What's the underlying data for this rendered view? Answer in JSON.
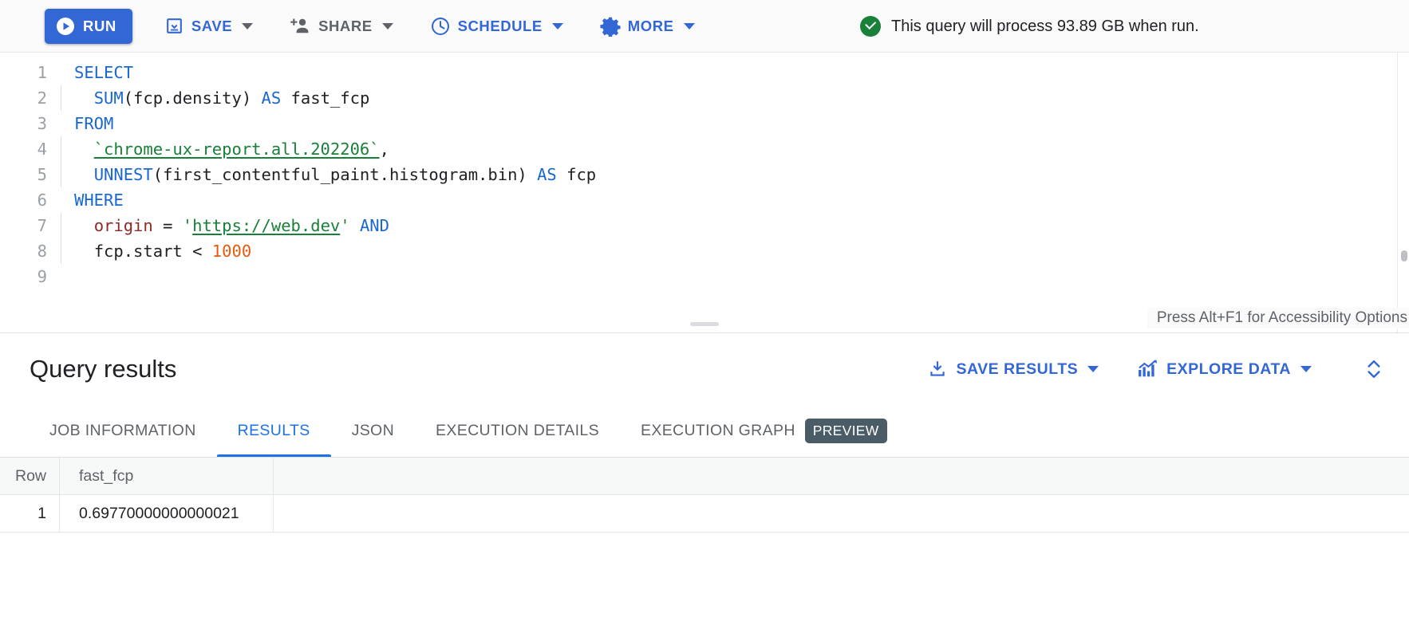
{
  "toolbar": {
    "run_label": "RUN",
    "save_label": "SAVE",
    "share_label": "SHARE",
    "schedule_label": "SCHEDULE",
    "more_label": "MORE",
    "status_text": "This query will process 93.89 GB when run.",
    "status_icon": "check-circle-icon",
    "accent_color": "#3367d6",
    "status_color": "#188038"
  },
  "editor": {
    "line_numbers": [
      "1",
      "2",
      "3",
      "4",
      "5",
      "6",
      "7",
      "8",
      "9"
    ],
    "lines": [
      {
        "n": "1",
        "tokens": [
          {
            "t": "SELECT",
            "c": "kw"
          }
        ]
      },
      {
        "n": "2",
        "tokens": [
          {
            "t": "  ",
            "c": "plain"
          },
          {
            "t": "SUM",
            "c": "kw"
          },
          {
            "t": "(fcp.density) ",
            "c": "plain"
          },
          {
            "t": "AS",
            "c": "kw"
          },
          {
            "t": " fast_fcp",
            "c": "plain"
          }
        ]
      },
      {
        "n": "3",
        "tokens": [
          {
            "t": "FROM",
            "c": "kw"
          }
        ]
      },
      {
        "n": "4",
        "tokens": [
          {
            "t": "  ",
            "c": "plain"
          },
          {
            "t": "`chrome-ux-report.all.202206`",
            "c": "tbl"
          },
          {
            "t": ",",
            "c": "plain"
          }
        ]
      },
      {
        "n": "5",
        "tokens": [
          {
            "t": "  ",
            "c": "plain"
          },
          {
            "t": "UNNEST",
            "c": "kw"
          },
          {
            "t": "(first_contentful_paint.histogram.bin) ",
            "c": "plain"
          },
          {
            "t": "AS",
            "c": "kw"
          },
          {
            "t": " fcp",
            "c": "plain"
          }
        ]
      },
      {
        "n": "6",
        "tokens": [
          {
            "t": "WHERE",
            "c": "kw"
          }
        ]
      },
      {
        "n": "7",
        "tokens": [
          {
            "t": "  ",
            "c": "plain"
          },
          {
            "t": "origin",
            "c": "ident"
          },
          {
            "t": " = ",
            "c": "plain"
          },
          {
            "t": "'",
            "c": "quote"
          },
          {
            "t": "https://web.dev",
            "c": "str"
          },
          {
            "t": "'",
            "c": "quote"
          },
          {
            "t": " ",
            "c": "plain"
          },
          {
            "t": "AND",
            "c": "kw"
          }
        ]
      },
      {
        "n": "8",
        "tokens": [
          {
            "t": "  ",
            "c": "plain"
          },
          {
            "t": "fcp.start ",
            "c": "plain"
          },
          {
            "t": "< ",
            "c": "plain"
          },
          {
            "t": "1000",
            "c": "num"
          }
        ]
      },
      {
        "n": "9",
        "tokens": []
      }
    ],
    "full_query": "SELECT\n  SUM(fcp.density) AS fast_fcp\nFROM\n  `chrome-ux-report.all.202206`,\n  UNNEST(first_contentful_paint.histogram.bin) AS fcp\nWHERE\n  origin = 'https://web.dev' AND\n  fcp.start < 1000\n",
    "accessibility_hint": "Press Alt+F1 for Accessibility Options"
  },
  "results": {
    "title": "Query results",
    "save_results_label": "SAVE RESULTS",
    "explore_data_label": "EXPLORE DATA",
    "expand_icon": "unfold-more-icon",
    "tabs": [
      {
        "label": "JOB INFORMATION",
        "active": false,
        "badge": ""
      },
      {
        "label": "RESULTS",
        "active": true,
        "badge": ""
      },
      {
        "label": "JSON",
        "active": false,
        "badge": ""
      },
      {
        "label": "EXECUTION DETAILS",
        "active": false,
        "badge": ""
      },
      {
        "label": "EXECUTION GRAPH",
        "active": false,
        "badge": "PREVIEW"
      }
    ],
    "table": {
      "columns": [
        "Row",
        "fast_fcp"
      ],
      "rows": [
        {
          "row": "1",
          "fast_fcp": "0.69770000000000021"
        }
      ]
    }
  }
}
